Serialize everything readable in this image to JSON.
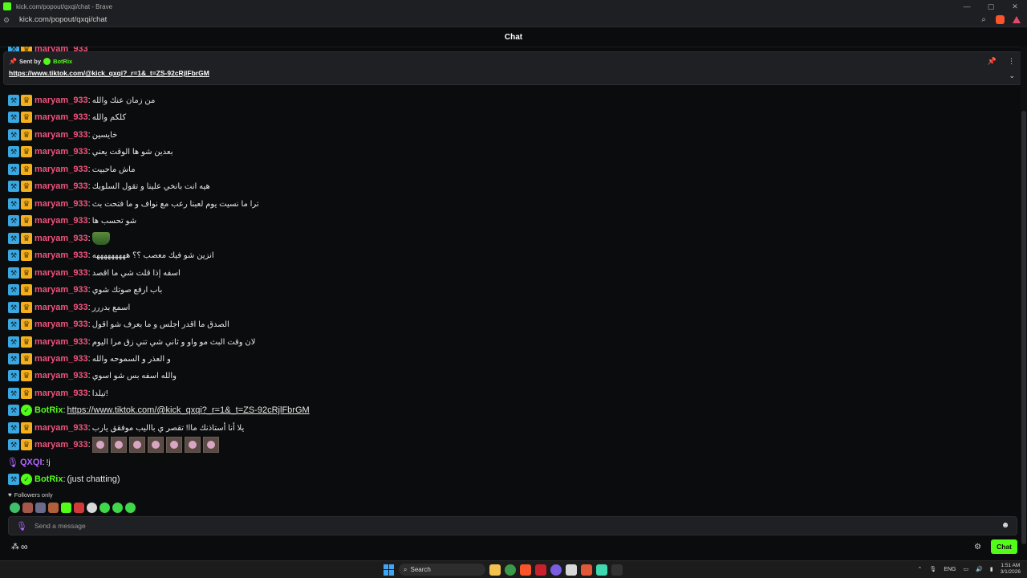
{
  "window": {
    "title": "kick.com/popout/qxqi/chat - Brave",
    "minimize": "—",
    "maximize": "▢",
    "close": "✕"
  },
  "address": {
    "url": "kick.com/popout/qxqi/chat"
  },
  "header": {
    "title": "Chat"
  },
  "pinned": {
    "sent_by": "Sent by",
    "author": "BotRix",
    "link": "https://www.tiktok.com/@kick_qxqi?_r=1&_t=ZS-92cRjlFbrGM"
  },
  "messages": [
    {
      "user": "maryam_933",
      "text": "من زمان عنك والله"
    },
    {
      "user": "maryam_933",
      "text": "كلكم والله"
    },
    {
      "user": "maryam_933",
      "text": "خايسين"
    },
    {
      "user": "maryam_933",
      "text": "بعدين شو ها الوقت يعني"
    },
    {
      "user": "maryam_933",
      "text": "ماش ماحبيت"
    },
    {
      "user": "maryam_933",
      "text": "هيه انت بانخي علينا و تقول السلوبك"
    },
    {
      "user": "maryam_933",
      "text": "ترا ما نسيت يوم لعبنا رعب مع نواف و ما فتحت بث"
    },
    {
      "user": "maryam_933",
      "text": "شو تحسب ها"
    },
    {
      "user": "maryam_933",
      "text": ""
    },
    {
      "user": "maryam_933",
      "text": "انزين شو فيك معصب ؟؟ هههههههههه"
    },
    {
      "user": "maryam_933",
      "text": "اسفه إذا قلت شي ما اقصد"
    },
    {
      "user": "maryam_933",
      "text": "باب ارفع صوتك شوي"
    },
    {
      "user": "maryam_933",
      "text": "اسمع بدررر"
    },
    {
      "user": "maryam_933",
      "text": "الصدق ما اقدر اجلس و ما بعرف شو اقول"
    },
    {
      "user": "maryam_933",
      "text": "لان وقت البث مو واو و ثاني شي تني زق مرا اليوم"
    },
    {
      "user": "maryam_933",
      "text": "و العذر و السموحه والله"
    },
    {
      "user": "maryam_933",
      "text": "والله اسفه بس شو اسوي"
    },
    {
      "user": "maryam_933",
      "text": "تيلدا!"
    },
    {
      "user": "BotRix",
      "text": "https://www.tiktok.com/@kick_qxqi?_r=1&_t=ZS-92cRjlFbrGM"
    },
    {
      "user": "maryam_933",
      "text": "يلا أنا أستاذنك ماا! تقصر ي بااليب موفقق يارب"
    },
    {
      "user": "maryam_933",
      "text": ""
    },
    {
      "user": "QXQI",
      "text": "!j"
    },
    {
      "user": "BotRix",
      "text": "(just chatting)"
    }
  ],
  "partial_top_user": "maryam_933",
  "followers_label": "Followers only",
  "input": {
    "placeholder": "Send a message"
  },
  "bottom": {
    "infinity": "∞",
    "chat_button": "Chat"
  },
  "taskbar": {
    "search": "Search",
    "lang": "ENG",
    "time": "1:51 AM",
    "date": "3/1/2026"
  },
  "colors": {
    "kick_green": "#53fc18",
    "maryam_name": "#f0547e",
    "qxqi_name": "#b066ff",
    "mod_badge": "#3aa7e0",
    "crown_badge": "#f2b01e"
  }
}
